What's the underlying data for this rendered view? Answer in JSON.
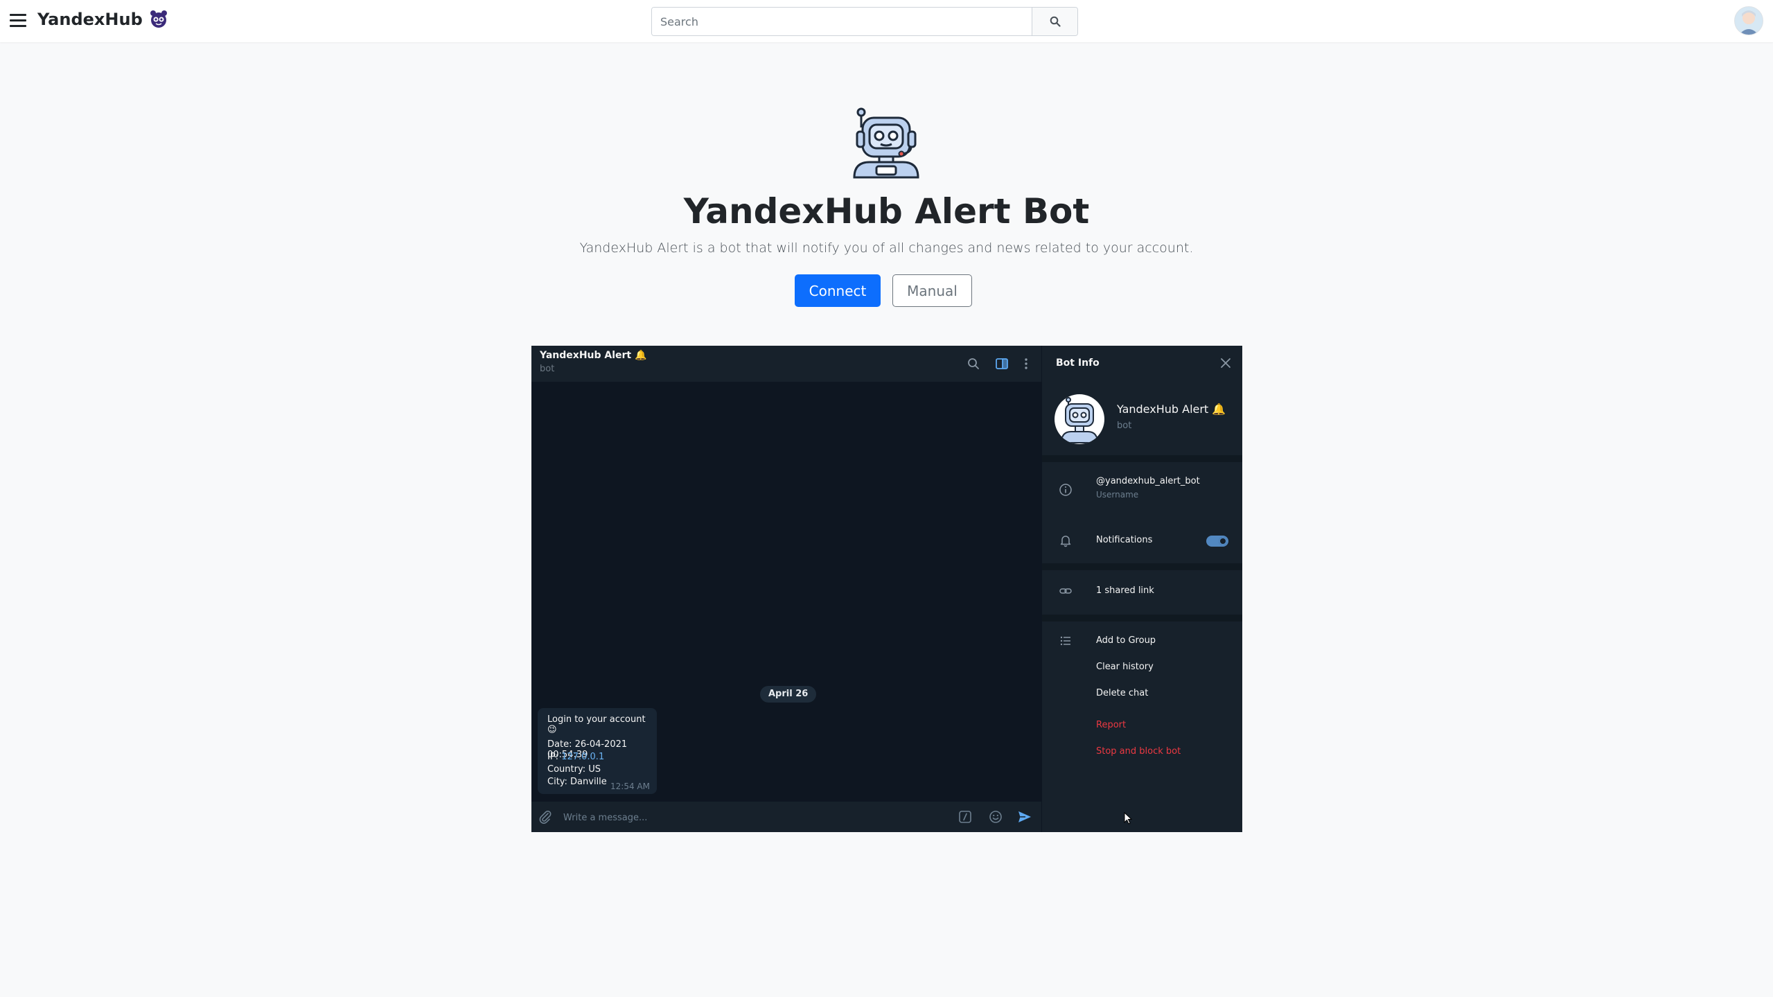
{
  "navbar": {
    "brand": "YandexHub",
    "search_placeholder": "Search"
  },
  "hero": {
    "title": "YandexHub Alert Bot",
    "description": "YandexHub Alert is a bot that will notify you of all changes and news related to your account.",
    "connect_label": "Connect",
    "manual_label": "Manual"
  },
  "chat": {
    "title": "YandexHub Alert 🔔",
    "subtitle": "bot",
    "date_badge": "April 26",
    "message": {
      "line1": "Login to your account 😉",
      "date_line": "Date: 26-04-2021 00:54:39",
      "ip_label": "IP: ",
      "ip_value": "127.0.0.1",
      "country_line": "Country: US",
      "city_line": "City: Danville",
      "time": "12:54 AM"
    },
    "input_placeholder": "Write a message..."
  },
  "bot_info": {
    "title": "Bot Info",
    "name": "YandexHub Alert 🔔",
    "subtitle": "bot",
    "username": "@yandexhub_alert_bot",
    "username_caption": "Username",
    "notifications_label": "Notifications",
    "notifications_on": true,
    "shared_links": "1 shared link",
    "add_to_group": "Add to Group",
    "clear_history": "Clear history",
    "delete_chat": "Delete chat",
    "report": "Report",
    "stop_block": "Stop and block bot"
  },
  "colors": {
    "primary": "#0d6efd",
    "tg_bg": "#0e1621",
    "tg_panel": "#17212b",
    "tg_accent": "#5288c1",
    "danger": "#ec3942"
  }
}
